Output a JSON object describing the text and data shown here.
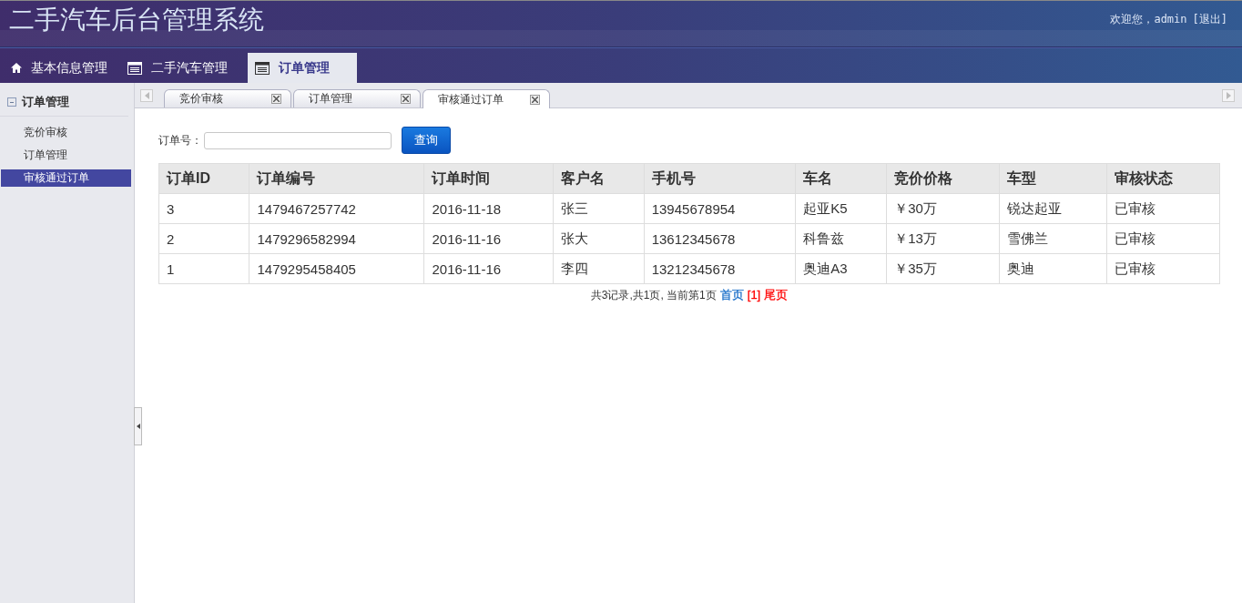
{
  "header": {
    "title": "二手汽车后台管理系统",
    "welcome": "欢迎您，admin",
    "logout": "[退出]"
  },
  "nav_tabs": [
    {
      "label": "基本信息管理",
      "kind": "home",
      "selected": false
    },
    {
      "label": "二手汽车管理",
      "kind": "list",
      "selected": false
    },
    {
      "label": "订单管理",
      "kind": "list",
      "selected": true
    }
  ],
  "sidebar": {
    "title": "订单管理",
    "expanded": true,
    "items": [
      {
        "label": "竞价审核",
        "selected": false
      },
      {
        "label": "订单管理",
        "selected": false
      },
      {
        "label": "审核通过订单",
        "selected": true
      }
    ]
  },
  "page_tabs": [
    {
      "label": "竞价审核",
      "selected": false
    },
    {
      "label": "订单管理",
      "selected": false
    },
    {
      "label": "审核通过订单",
      "selected": true
    }
  ],
  "search": {
    "label": "订单号：",
    "button": "查询"
  },
  "table": {
    "columns": [
      "订单ID",
      "订单编号",
      "订单时间",
      "客户名",
      "手机号",
      "车名",
      "竞价价格",
      "车型",
      "审核状态"
    ],
    "rows": [
      [
        "3",
        "1479467257742",
        "2016-11-18",
        "张三",
        "13945678954",
        "起亚K5",
        "￥30万",
        "锐达起亚",
        "已审核"
      ],
      [
        "2",
        "1479296582994",
        "2016-11-16",
        "张大",
        "13612345678",
        "科鲁兹",
        "￥13万",
        "雪佛兰",
        "已审核"
      ],
      [
        "1",
        "1479295458405",
        "2016-11-16",
        "李四",
        "13212345678",
        "奥迪A3",
        "￥35万",
        "奥迪",
        "已审核"
      ]
    ]
  },
  "pagination": {
    "summary": "共3记录,共1页, 当前第1页",
    "links": [
      {
        "label": "首页",
        "color": "#1a6fc9"
      },
      {
        "label": "[1]",
        "color": "#ff0000"
      },
      {
        "label": "尾页",
        "color": "#ff0000"
      }
    ]
  }
}
